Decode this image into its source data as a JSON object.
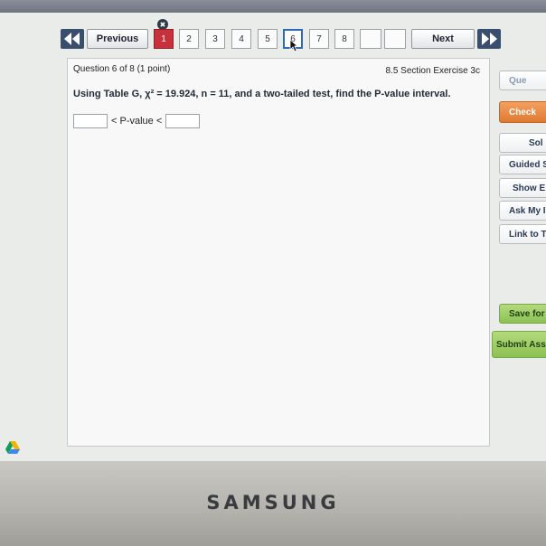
{
  "brand": "SAMSUNG",
  "nav": {
    "previous_label": "Previous",
    "next_label": "Next",
    "pages": [
      "1",
      "2",
      "3",
      "4",
      "5",
      "6",
      "7",
      "8",
      "",
      ""
    ],
    "badge": "✖"
  },
  "question": {
    "number_label": "Question 6 of 8 (1 point)",
    "section_label": "8.5 Section Exercise 3c",
    "text": "Using Table G, χ² = 19.924, n = 11, and a two-tailed test, find the P-value interval.",
    "answer": {
      "lower_value": "",
      "middle_label": "< P-value <",
      "upper_value": ""
    }
  },
  "side_buttons": [
    "Que",
    "Check",
    "Sol",
    "Guided S",
    "Show E",
    "Ask My In",
    "Link to Te",
    "Save for",
    "Submit Assi"
  ],
  "colors": {
    "current_page_border": "#2c6bb8",
    "answered_page": "#c8303b",
    "check_button": "#e07a32",
    "submit_button": "#8cc153"
  }
}
